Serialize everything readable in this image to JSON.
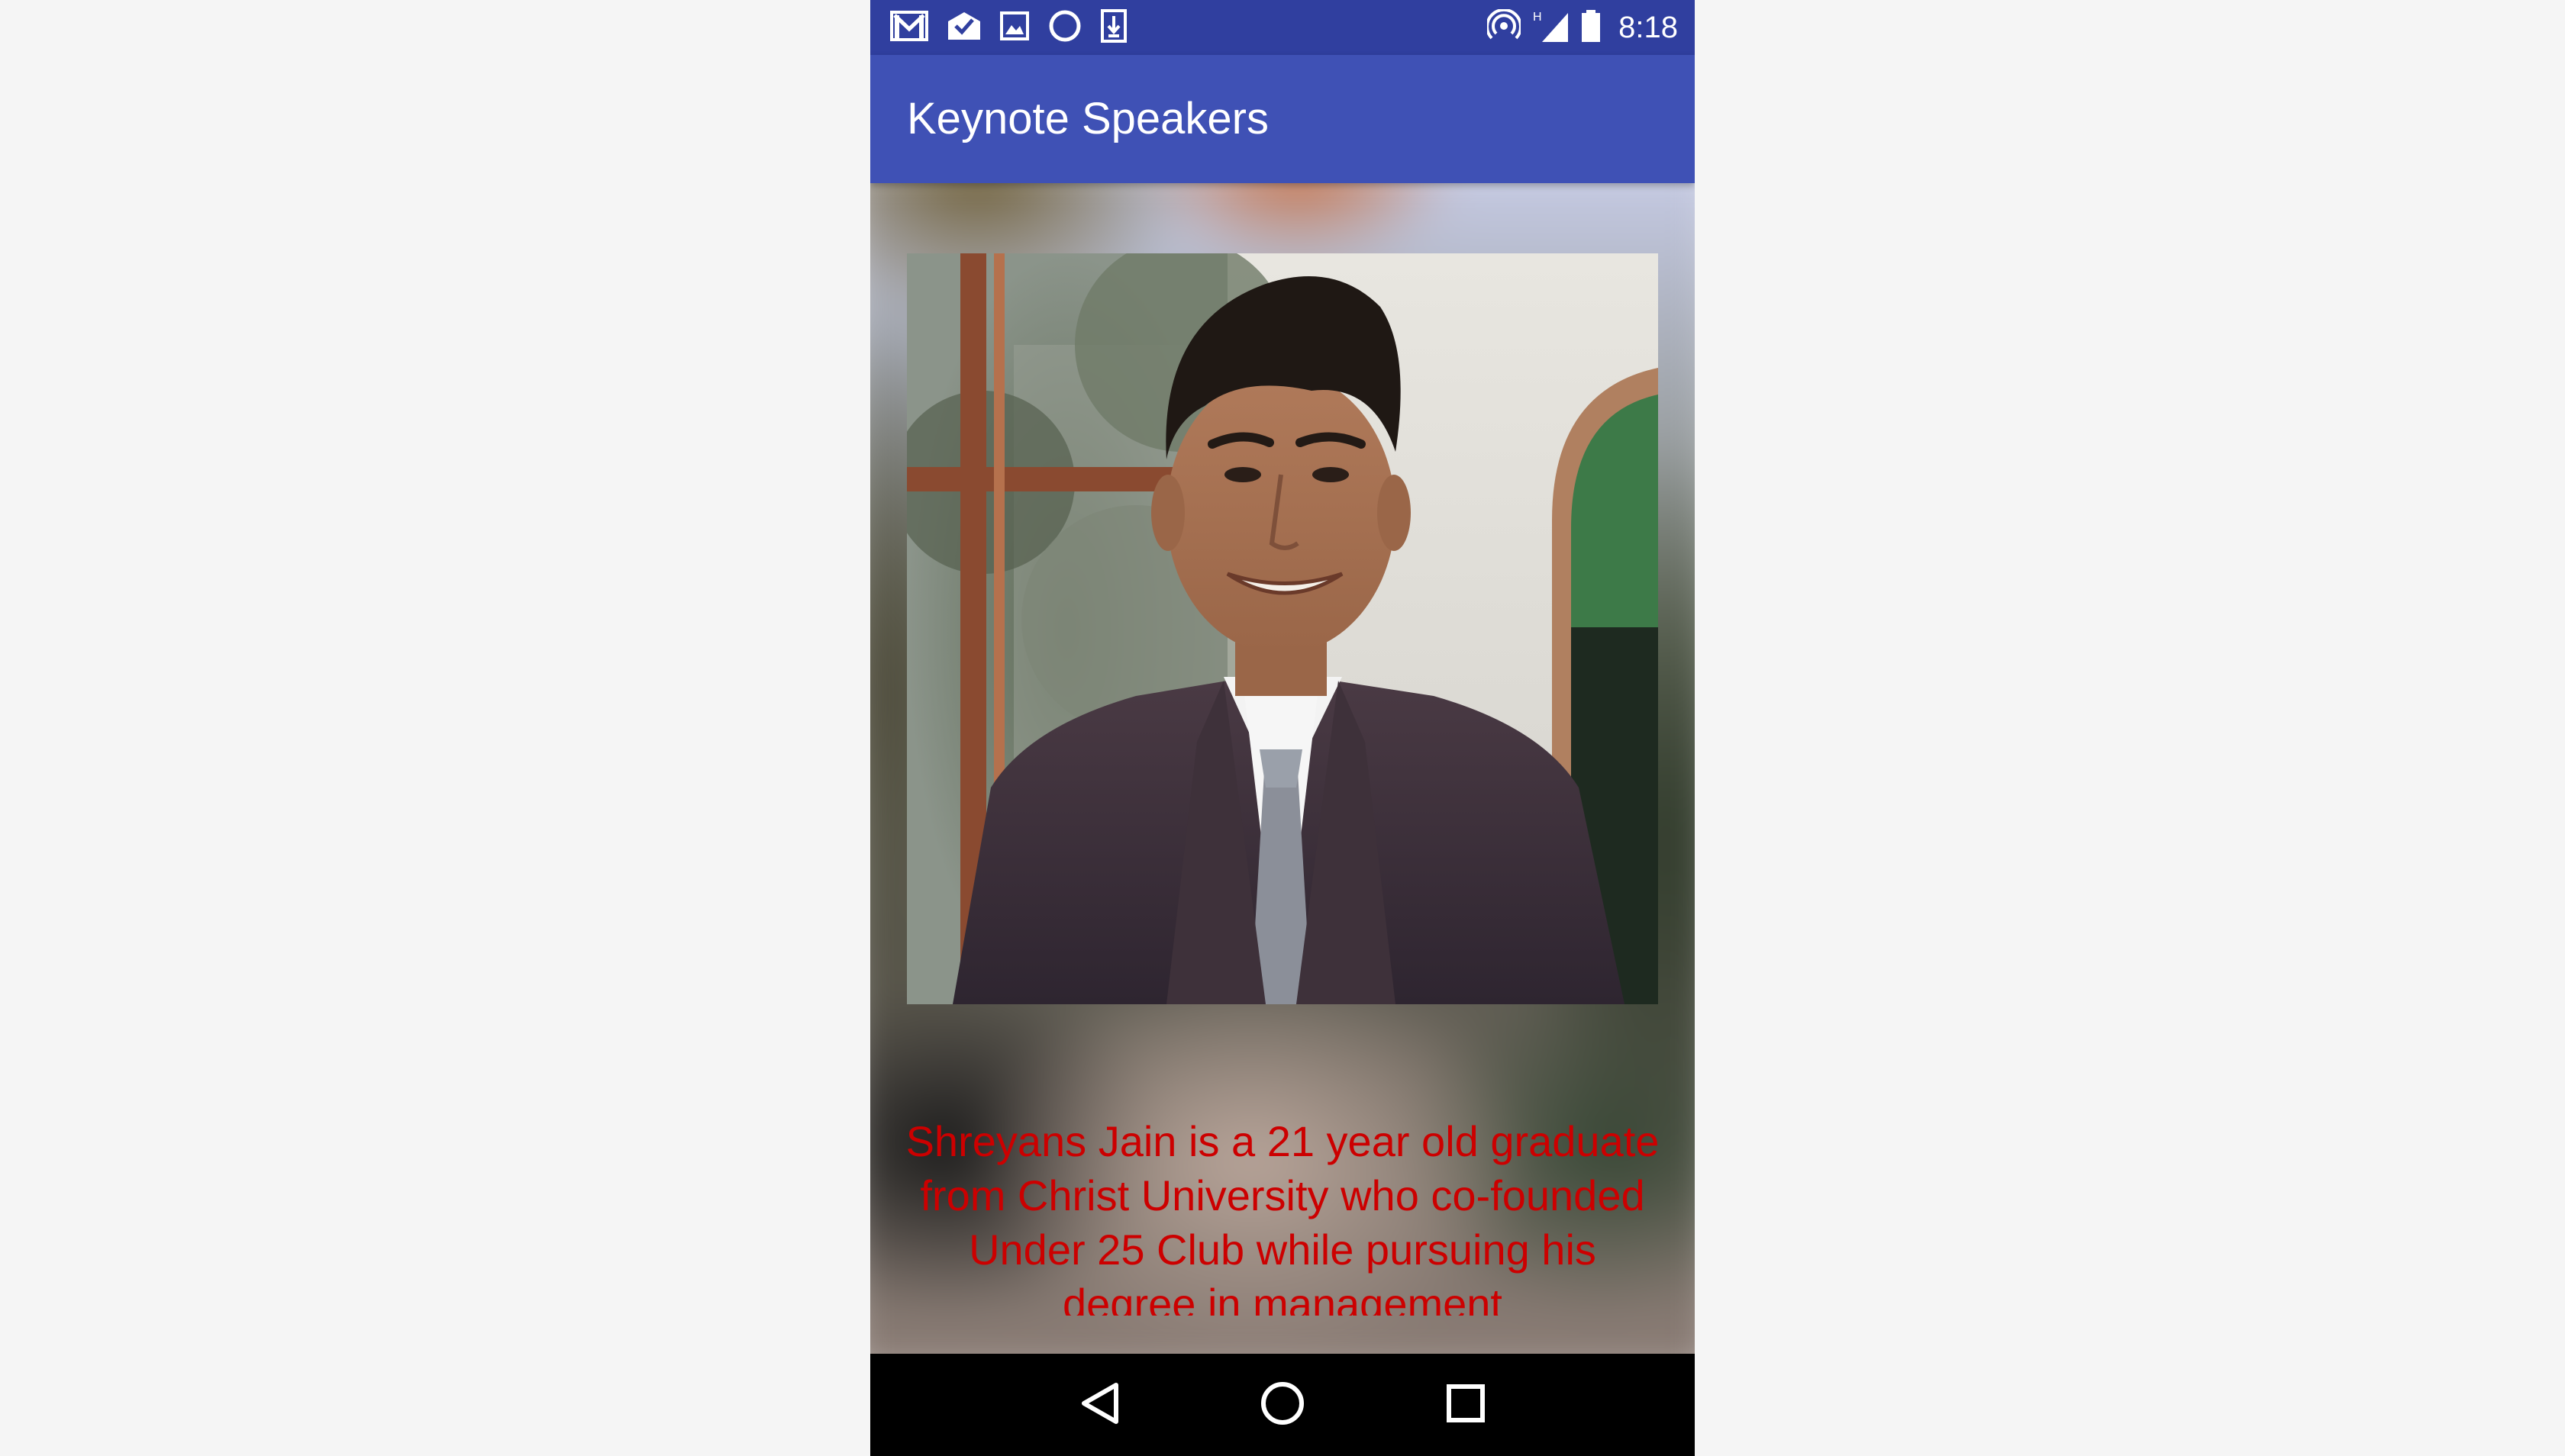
{
  "status_bar": {
    "time": "8:18",
    "network_type": "H",
    "left_icons": [
      "gmail-icon",
      "inbox-check-icon",
      "image-icon",
      "circle-icon",
      "download-icon"
    ],
    "right_icons": [
      "hotspot-icon",
      "signal-icon",
      "battery-icon"
    ]
  },
  "app_bar": {
    "title": "Keynote Speakers"
  },
  "speaker": {
    "photo_alt": "Portrait of a smiling young man in a dark suit and grey tie",
    "bio": "Shreyans Jain is a 21 year old graduate from Christ University who co-founded Under 25 Club while pursuing his degree in management"
  },
  "nav_bar": {
    "buttons": [
      "back",
      "home",
      "recents"
    ]
  },
  "colors": {
    "status_bar": "#303f9f",
    "app_bar": "#3f51b5",
    "bio_text": "#cc0000"
  }
}
